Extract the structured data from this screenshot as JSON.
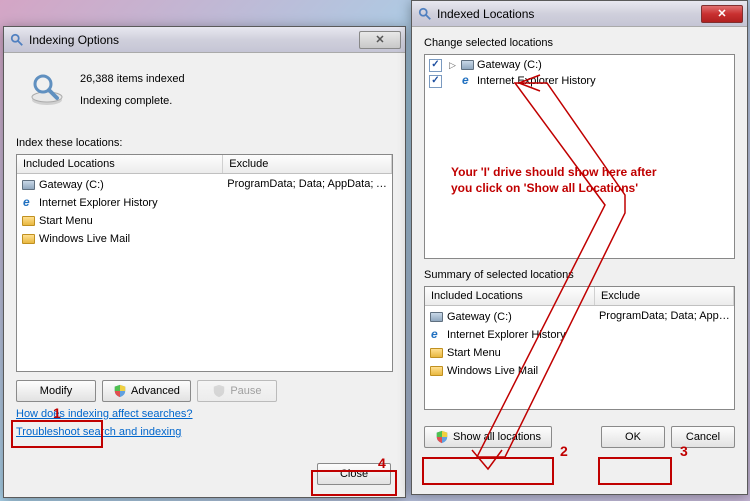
{
  "win1": {
    "title": "Indexing Options",
    "items_indexed": "26,388 items indexed",
    "status": "Indexing complete.",
    "section_label": "Index these locations:",
    "col_included": "Included Locations",
    "col_exclude": "Exclude",
    "rows": [
      {
        "icon": "hdd",
        "name": "Gateway (C:)",
        "exclude": "ProgramData; Data; AppData; AppData; ..."
      },
      {
        "icon": "ie",
        "name": "Internet Explorer History",
        "exclude": ""
      },
      {
        "icon": "folder",
        "name": "Start Menu",
        "exclude": ""
      },
      {
        "icon": "folder",
        "name": "Windows Live Mail",
        "exclude": ""
      }
    ],
    "btn_modify": "Modify",
    "btn_advanced": "Advanced",
    "btn_pause": "Pause",
    "link_how": "How does indexing affect searches?",
    "link_trouble": "Troubleshoot search and indexing",
    "btn_close": "Close"
  },
  "win2": {
    "title": "Indexed Locations",
    "change_label": "Change selected locations",
    "tree": [
      {
        "checked": true,
        "expander": "▷",
        "icon": "hdd",
        "name": "Gateway (C:)"
      },
      {
        "checked": true,
        "expander": "",
        "icon": "ie",
        "name": "Internet Explorer History"
      }
    ],
    "summary_label": "Summary of selected locations",
    "col_included": "Included Locations",
    "col_exclude": "Exclude",
    "rows": [
      {
        "icon": "hdd",
        "name": "Gateway (C:)",
        "exclude": "ProgramData; Data; AppData; ..."
      },
      {
        "icon": "ie",
        "name": "Internet Explorer History",
        "exclude": ""
      },
      {
        "icon": "folder",
        "name": "Start Menu",
        "exclude": ""
      },
      {
        "icon": "folder",
        "name": "Windows Live Mail",
        "exclude": ""
      }
    ],
    "btn_show_all": "Show all locations",
    "btn_ok": "OK",
    "btn_cancel": "Cancel"
  },
  "annotations": {
    "n1": "1",
    "n2": "2",
    "n3": "3",
    "n4": "4",
    "note": "Your 'I' drive should show here after you click on 'Show all Locations'"
  }
}
